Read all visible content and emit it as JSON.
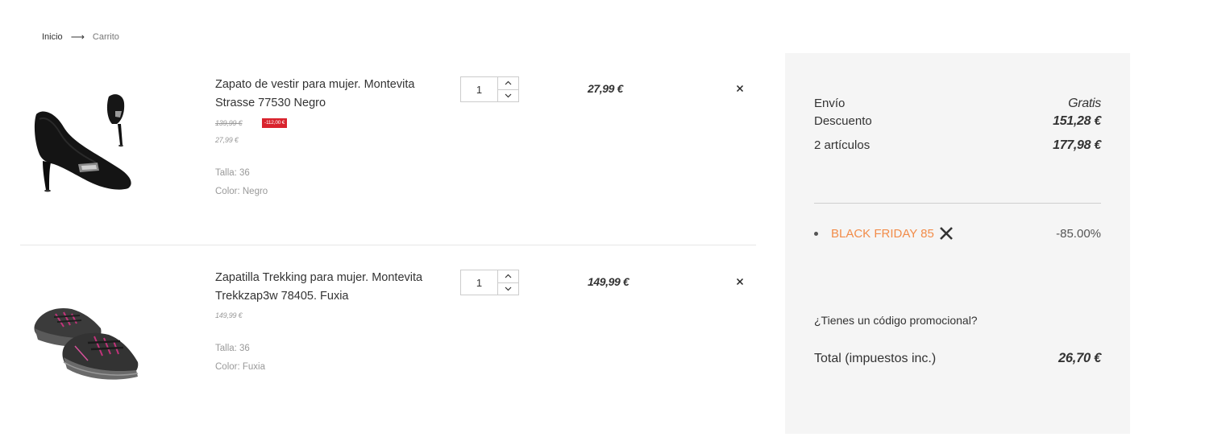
{
  "breadcrumb": {
    "home": "Inicio",
    "arrow": "⟶",
    "current": "Carrito"
  },
  "items": [
    {
      "name": "Zapato de vestir para mujer. Montevita Strasse 77530 Negro",
      "old_price": "139,99 €",
      "discount": "-112,00 €",
      "unit_price": "27,99 €",
      "size": "Talla: 36",
      "color": "Color: Negro",
      "quantity": "1",
      "line_total": "27,99 €",
      "remove_icon": "close-icon",
      "image": "black-heel-shoe"
    },
    {
      "name": "Zapatilla Trekking para mujer. Montevita Trekkzap3w 78405. Fuxia",
      "unit_price": "149,99 €",
      "size": "Talla: 36",
      "color": "Color: Fuxia",
      "quantity": "1",
      "line_total": "149,99 €",
      "remove_icon": "close-icon",
      "image": "trekking-sneaker"
    }
  ],
  "summary": {
    "shipping_label": "Envío",
    "shipping_value": "Gratis",
    "discount_label": "Descuento",
    "discount_value": "151,28 €",
    "items_label": "2 artículos",
    "items_value": "177,98 €",
    "voucher_name": "BLACK FRIDAY 85",
    "voucher_value": "-85.00%",
    "promo_link": "¿Tienes un código promocional?",
    "total_label": "Total (impuestos inc.)",
    "total_value": "26,70 €"
  },
  "colors": {
    "accent": "#f28c49",
    "discount_badge": "#d9232d",
    "summary_bg": "#f5f5f5"
  }
}
